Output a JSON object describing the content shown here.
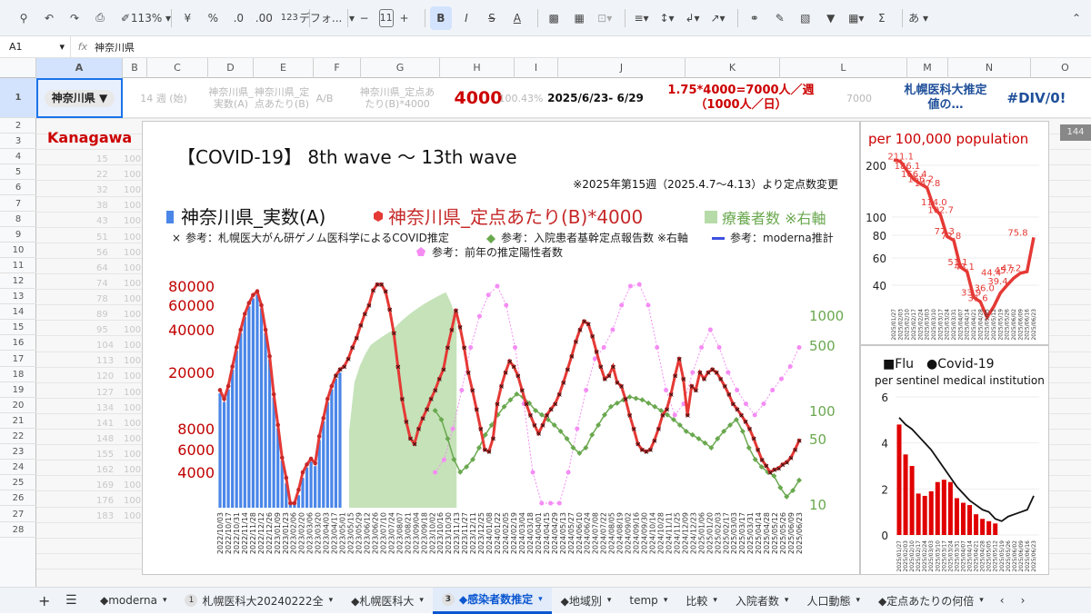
{
  "toolbar": {
    "zoom": "113%",
    "currency": "¥",
    "percent": "%",
    "decimal_decrease": ".0",
    "decimal_increase": ".00",
    "number_format": "123",
    "font": "デフォ...",
    "font_size": "11",
    "minus": "−",
    "plus": "+",
    "bold": "B",
    "italic": "I",
    "strike": "S",
    "text_color": "A",
    "sum": "Σ",
    "input_mode": "あ"
  },
  "formula_bar": {
    "cell_ref": "A1",
    "fx": "fx",
    "content": "神奈川県"
  },
  "columns": [
    "A",
    "B",
    "C",
    "D",
    "E",
    "F",
    "G",
    "H",
    "I",
    "J",
    "K",
    "L",
    "M",
    "N",
    "O"
  ],
  "rows": [
    "1",
    "2",
    "3",
    "4",
    "5",
    "6",
    "7",
    "8",
    "9",
    "10",
    "11",
    "12",
    "13",
    "14",
    "15",
    "16",
    "17",
    "18",
    "19",
    "20",
    "21",
    "22",
    "23",
    "24",
    "25",
    "26",
    "27",
    "28"
  ],
  "row1": {
    "a_dropdown": "神奈川県",
    "b": "14 週 (始)",
    "d": "神奈川県_実数(A)",
    "e": "神奈川県_定点あたり(B)",
    "f": "A/B",
    "g": "神奈川県_定点あたり(B)*4000",
    "h": "4000",
    "i": "100.43%",
    "j": "2025/6/23- 6/29",
    "k": "1.75*4000=7000人／週（1000人／日）",
    "m": "7000",
    "n": "札幌医科大推定値の…",
    "o": "#DIV/0!"
  },
  "grid": {
    "kanagawa_label": "Kanagawa",
    "right_value": "144",
    "col_c_values": [
      "15",
      "22",
      "32",
      "38",
      "43",
      "51",
      "56",
      "64",
      "74",
      "78",
      "89",
      "95",
      "104",
      "113",
      "120",
      "127",
      "134",
      "141",
      "148",
      "155",
      "162",
      "169",
      "176",
      "183"
    ],
    "col_d_prefix": "100"
  },
  "main_chart": {
    "title": "【COVID-19】 8th wave 〜 13th wave",
    "note": "※2025年第15週（2025.4.7〜4.13）より定点数変更",
    "legend": {
      "actual": "神奈川県_実数(A)",
      "per_sentinel": "神奈川県_定点あたり(B)*4000",
      "recovering": "療養者数 ※右軸",
      "sapporo": "参考：札幌医大がん研ゲノム医科学によるCOVID推定",
      "inpatient": "参考：入院患者基幹定点報告数 ※右軸",
      "moderna": "参考：moderna推計",
      "prev_year": "参考：前年の推定陽性者数"
    },
    "colors": {
      "actual": "#4a86e8",
      "per_sentinel": "#e53935",
      "recovering": "#b7dba8",
      "inpatient": "#6aa84f",
      "prev_year": "#f48cf4"
    }
  },
  "chart_data": [
    {
      "type": "line",
      "title": "【COVID-19】 8th wave 〜 13th wave",
      "y_ticks": [
        "80000",
        "60000",
        "40000",
        "20000",
        "8000",
        "6000",
        "4000"
      ],
      "y2_ticks": [
        "1000",
        "500",
        "100",
        "50",
        "10"
      ],
      "x_ticks": [
        "2022/10/03",
        "2022/10/17",
        "2022/10/31",
        "2022/11/14",
        "2022/11/28",
        "2022/12/12",
        "2022/12/26",
        "2023/01/09",
        "2023/01/23",
        "2023/02/06",
        "2023/02/20",
        "2023/03/06",
        "2023/03/20",
        "2023/04/03",
        "2023/04/17",
        "2023/05/01",
        "2023/05/15",
        "2023/05/29",
        "2023/06/12",
        "2023/06/26",
        "2023/07/10",
        "2023/07/24",
        "2023/08/07",
        "2023/08/21",
        "2023/09/04",
        "2023/09/18",
        "2023/10/02",
        "2023/10/16",
        "2023/10/30",
        "2023/11/13",
        "2023/11/27",
        "2023/12/11",
        "2023/12/25",
        "2024/01/08",
        "2024/01/22",
        "2024/02/05",
        "2024/02/19",
        "2024/03/04",
        "2024/03/18",
        "2024/04/01",
        "2024/04/15",
        "2024/04/29",
        "2024/05/13",
        "2024/05/27",
        "2024/06/10",
        "2024/06/24",
        "2024/07/08",
        "2024/07/22",
        "2024/08/05",
        "2024/08/19",
        "2024/09/02",
        "2024/09/16",
        "2024/09/30",
        "2024/10/14",
        "2024/10/28",
        "2024/11/11",
        "2024/11/25",
        "2024/12/09",
        "2024/12/23",
        "2025/01/06",
        "2025/01/20",
        "2025/02/03",
        "2025/02/17",
        "2025/03/03",
        "2025/03/17",
        "2025/03/31",
        "2025/04/14",
        "2025/04/28",
        "2025/05/12",
        "2025/05/26",
        "2025/06/09",
        "2025/06/23"
      ],
      "series": [
        {
          "name": "神奈川県_定点あたり(B)*4000",
          "values": [
            15000,
            13000,
            16000,
            22000,
            30000,
            40000,
            52000,
            62000,
            70000,
            74000,
            60000,
            40000,
            26000,
            14000,
            8500,
            5200,
            3800,
            3000,
            2900,
            3400,
            4000,
            4600,
            5100,
            4700,
            7200,
            9500,
            13000,
            16000,
            19000,
            21000,
            22000,
            25000,
            30000,
            35000,
            43000,
            52000,
            60000,
            75000,
            82000,
            82000,
            74000,
            56000,
            38000,
            22000,
            13000,
            9000,
            7000,
            6500,
            8000,
            9500,
            11000,
            13000,
            15000,
            18000,
            21000,
            30000,
            40000,
            55000,
            42000,
            30000,
            20000,
            15000,
            11000,
            8000,
            6000,
            5800,
            7000,
            12000,
            16000,
            20000,
            24000,
            22000,
            19000,
            15000,
            12000,
            10000,
            8500,
            7500,
            8500,
            10000,
            11000,
            12000,
            14000,
            17000,
            21000,
            26000,
            33000,
            40000,
            46000,
            44000,
            36000,
            28000,
            22000,
            18000,
            19000,
            22000,
            17000,
            16000,
            13000,
            10000,
            8000,
            6500,
            6000,
            5800,
            6000,
            6800,
            8000,
            10000,
            11000,
            14000,
            19000,
            25000,
            18000,
            10000,
            16000,
            15000,
            20000,
            18000,
            20000,
            21000,
            20000,
            18000,
            16000,
            14000,
            12000,
            11000,
            10000,
            9000,
            8000,
            7000,
            6000,
            5000,
            4500,
            4000,
            4200,
            4300,
            4600,
            4800,
            5200,
            6000,
            6800
          ]
        },
        {
          "name": "療養者数 ※右軸",
          "values": [
            0,
            0,
            0,
            0,
            0,
            0,
            0,
            0,
            0,
            0,
            0,
            0,
            0,
            0,
            0,
            0,
            0,
            0,
            0,
            0,
            0,
            0,
            0,
            0,
            60,
            200,
            300,
            400,
            500,
            550,
            600,
            650,
            700,
            800,
            900,
            1000,
            1100,
            1200,
            1300,
            1400,
            1500,
            1600,
            1700,
            1300,
            900
          ]
        },
        {
          "name": "参考：入院患者基幹定点報告数 ※右軸",
          "values": [
            100,
            80,
            50,
            30,
            22,
            25,
            30,
            40,
            55,
            70,
            90,
            110,
            130,
            150,
            140,
            120,
            100,
            90,
            80,
            70,
            60,
            50,
            40,
            35,
            40,
            55,
            70,
            90,
            110,
            120,
            130,
            140,
            135,
            130,
            120,
            110,
            100,
            90,
            80,
            70,
            60,
            55,
            50,
            45,
            40,
            50,
            60,
            70,
            80,
            60,
            40,
            30,
            25,
            22,
            20,
            15,
            12,
            14,
            18
          ]
        },
        {
          "name": "参考：前年の推定陽性者数",
          "values": [
            4000,
            5000,
            8000,
            15000,
            30000,
            50000,
            70000,
            80000,
            60000,
            30000,
            12000,
            4000,
            2000,
            1800,
            2500,
            4000,
            8000,
            15000,
            25000,
            30000,
            40000,
            60000,
            80000,
            82000,
            60000,
            30000,
            15000,
            10000,
            12000,
            20000,
            30000,
            40000,
            30000,
            20000,
            15000,
            12000,
            10000,
            12000,
            15000,
            18000,
            22000,
            30000
          ]
        }
      ]
    },
    {
      "type": "line",
      "title": "per 100,000 population",
      "y_ticks": [
        "200",
        "100",
        "80",
        "60",
        "40"
      ],
      "x_ticks": [
        "2025/01/27",
        "2025/02/03",
        "2025/02/10",
        "2025/02/17",
        "2025/02/24",
        "2025/03/03",
        "2025/03/10",
        "2025/03/17",
        "2025/03/24",
        "2025/03/31",
        "2025/04/07",
        "2025/04/14",
        "2025/04/21",
        "2025/04/28",
        "2025/05/05",
        "2025/05/12",
        "2025/05/19",
        "2025/05/26",
        "2025/06/02",
        "2025/06/09",
        "2025/06/16",
        "2025/06/23"
      ],
      "labels": [
        "211.1",
        "186.1",
        "166.4",
        "156.2",
        "147.8",
        "114.0",
        "102.7",
        "77.3",
        "72.8",
        "51.1",
        "48.1",
        "33.9",
        "31.6",
        "36.0",
        "44.4",
        "39.4",
        "45.7",
        "47.2",
        "75.8"
      ],
      "values": [
        215,
        211,
        186,
        166,
        156,
        148,
        114,
        103,
        77,
        73,
        51,
        48,
        34,
        32,
        26,
        30,
        36,
        40,
        44,
        47,
        48,
        76
      ]
    },
    {
      "type": "bar",
      "title": "■Flu　●Covid-19",
      "subtitle": "per sentinel medical institution",
      "y_ticks": [
        "6",
        "4",
        "2",
        "0"
      ],
      "x_ticks": [
        "2025/01/27",
        "2025/02/03",
        "2025/02/10",
        "2025/02/17",
        "2025/02/24",
        "2025/03/03",
        "2025/03/10",
        "2025/03/17",
        "2025/03/24",
        "2025/03/31",
        "2025/04/07",
        "2025/04/14",
        "2025/04/21",
        "2025/04/28",
        "2025/05/05",
        "2025/05/12",
        "2025/05/19",
        "2025/05/26",
        "2025/06/02",
        "2025/06/09",
        "2025/06/16",
        "2025/06/23"
      ],
      "series": [
        {
          "name": "Flu",
          "values": [
            4.8,
            3.5,
            3.0,
            1.8,
            1.7,
            1.9,
            2.3,
            2.4,
            2.3,
            1.6,
            1.4,
            1.3,
            0.9,
            0.7,
            0.6,
            0.5,
            0,
            0,
            0,
            0,
            0,
            0
          ]
        },
        {
          "name": "Covid-19",
          "values": [
            5.1,
            4.8,
            4.6,
            4.3,
            4.0,
            3.7,
            3.3,
            2.9,
            2.5,
            2.1,
            1.8,
            1.5,
            1.3,
            1.1,
            1.0,
            0.7,
            0.6,
            0.8,
            0.9,
            1.0,
            1.1,
            1.7
          ]
        }
      ]
    }
  ],
  "sheet_tabs": [
    {
      "label": "◆moderna"
    },
    {
      "label": "札幌医科大20240222全",
      "badge": "1"
    },
    {
      "label": "◆札幌医科大"
    },
    {
      "label": "◆感染者数推定",
      "badge": "3",
      "active": true
    },
    {
      "label": "◆地域別"
    },
    {
      "label": "temp"
    },
    {
      "label": "比較"
    },
    {
      "label": "入院者数"
    },
    {
      "label": "人口動態"
    },
    {
      "label": "◆定点あたりの何倍"
    }
  ]
}
